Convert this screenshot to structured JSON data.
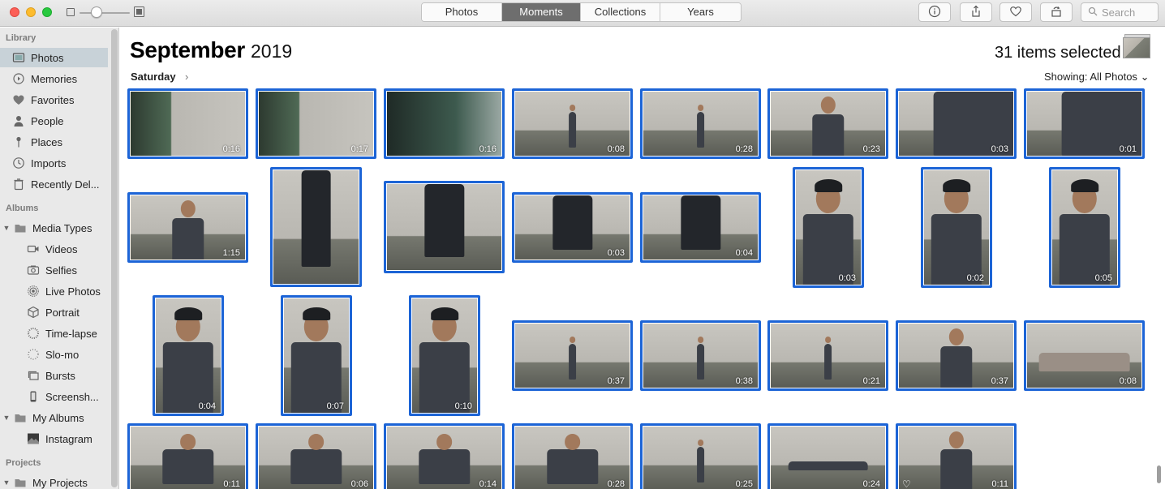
{
  "toolbar": {
    "tabs": [
      {
        "label": "Photos",
        "active": false
      },
      {
        "label": "Moments",
        "active": true
      },
      {
        "label": "Collections",
        "active": false
      },
      {
        "label": "Years",
        "active": false
      }
    ],
    "search_placeholder": "Search",
    "buttons": [
      "info-icon",
      "share-icon",
      "heart-icon",
      "rotate-icon"
    ]
  },
  "sidebar": {
    "library_header": "Library",
    "library_items": [
      {
        "label": "Photos",
        "icon": "photos-icon",
        "selected": true
      },
      {
        "label": "Memories",
        "icon": "memories-icon"
      },
      {
        "label": "Favorites",
        "icon": "heart-icon"
      },
      {
        "label": "People",
        "icon": "person-icon"
      },
      {
        "label": "Places",
        "icon": "pin-icon"
      },
      {
        "label": "Imports",
        "icon": "clock-icon"
      },
      {
        "label": "Recently Del...",
        "icon": "trash-icon"
      }
    ],
    "albums_header": "Albums",
    "media_types": "Media Types",
    "media_items": [
      {
        "label": "Videos",
        "icon": "video-icon"
      },
      {
        "label": "Selfies",
        "icon": "selfie-icon"
      },
      {
        "label": "Live Photos",
        "icon": "live-icon"
      },
      {
        "label": "Portrait",
        "icon": "cube-icon"
      },
      {
        "label": "Time-lapse",
        "icon": "timelapse-icon"
      },
      {
        "label": "Slo-mo",
        "icon": "slomo-icon"
      },
      {
        "label": "Bursts",
        "icon": "bursts-icon"
      },
      {
        "label": "Screensh...",
        "icon": "screenshot-icon"
      }
    ],
    "my_albums": "My Albums",
    "album_items": [
      {
        "label": "Instagram",
        "icon": "album-thumb-icon"
      }
    ],
    "projects_header": "Projects",
    "my_projects": "My Projects"
  },
  "main": {
    "month": "September",
    "year": "2019",
    "selected_count": "31 items selected",
    "day": "Saturday",
    "showing_label": "Showing:",
    "showing_value": "All Photos",
    "accent": "#1c64d6",
    "tiles": [
      {
        "dur": "0:16",
        "kind": "room"
      },
      {
        "dur": "0:17",
        "kind": "room"
      },
      {
        "dur": "0:16",
        "kind": "window"
      },
      {
        "dur": "0:08",
        "kind": "stand-far"
      },
      {
        "dur": "0:28",
        "kind": "stand-far"
      },
      {
        "dur": "0:23",
        "kind": "torso"
      },
      {
        "dur": "0:03",
        "kind": "close"
      },
      {
        "dur": "0:01",
        "kind": "close"
      },
      {
        "dur": "1:15",
        "kind": "torso"
      },
      {
        "dur": "",
        "kind": "legs"
      },
      {
        "dur": "",
        "kind": "legs"
      },
      {
        "dur": "0:03",
        "kind": "legs"
      },
      {
        "dur": "0:04",
        "kind": "legs"
      },
      {
        "dur": "0:03",
        "kind": "portrait"
      },
      {
        "dur": "0:02",
        "kind": "portrait"
      },
      {
        "dur": "0:05",
        "kind": "portrait"
      },
      {
        "dur": "0:04",
        "kind": "portrait"
      },
      {
        "dur": "0:07",
        "kind": "portrait"
      },
      {
        "dur": "0:10",
        "kind": "portrait"
      },
      {
        "dur": "0:37",
        "kind": "stand-far"
      },
      {
        "dur": "0:38",
        "kind": "stand-far"
      },
      {
        "dur": "0:21",
        "kind": "stand-far"
      },
      {
        "dur": "0:37",
        "kind": "torso"
      },
      {
        "dur": "0:08",
        "kind": "floor"
      },
      {
        "dur": "0:11",
        "kind": "crawl"
      },
      {
        "dur": "0:06",
        "kind": "crawl"
      },
      {
        "dur": "0:14",
        "kind": "crawl"
      },
      {
        "dur": "0:28",
        "kind": "crawl"
      },
      {
        "dur": "0:25",
        "kind": "stand-far"
      },
      {
        "dur": "0:24",
        "kind": "pushup"
      },
      {
        "dur": "0:11",
        "kind": "torso",
        "favorite": true
      }
    ]
  }
}
